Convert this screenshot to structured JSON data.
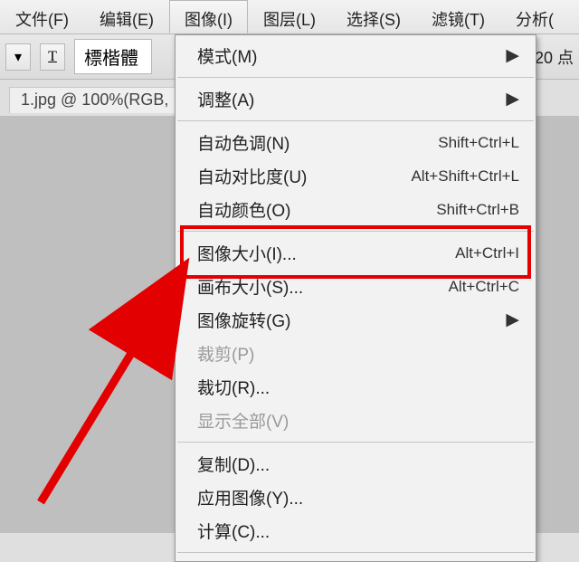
{
  "menubar": {
    "items": [
      {
        "label": "文件(F)"
      },
      {
        "label": "编辑(E)"
      },
      {
        "label": "图像(I)"
      },
      {
        "label": "图层(L)"
      },
      {
        "label": "选择(S)"
      },
      {
        "label": "滤镜(T)"
      },
      {
        "label": "分析("
      }
    ],
    "active_index": 2
  },
  "toolbar": {
    "font_name": "標楷體",
    "points_label": "20 点"
  },
  "doc_tab": {
    "label": "1.jpg @ 100%(RGB,"
  },
  "dropdown": {
    "groups": [
      [
        {
          "label": "模式(M)",
          "submenu": true
        }
      ],
      [
        {
          "label": "调整(A)",
          "submenu": true
        }
      ],
      [
        {
          "label": "自动色调(N)",
          "shortcut": "Shift+Ctrl+L"
        },
        {
          "label": "自动对比度(U)",
          "shortcut": "Alt+Shift+Ctrl+L"
        },
        {
          "label": "自动颜色(O)",
          "shortcut": "Shift+Ctrl+B"
        }
      ],
      [
        {
          "label": "图像大小(I)...",
          "shortcut": "Alt+Ctrl+I",
          "highlight": true
        },
        {
          "label": "画布大小(S)...",
          "shortcut": "Alt+Ctrl+C"
        },
        {
          "label": "图像旋转(G)",
          "submenu": true
        },
        {
          "label": "裁剪(P)",
          "disabled": true
        },
        {
          "label": "裁切(R)..."
        },
        {
          "label": "显示全部(V)",
          "disabled": true
        }
      ],
      [
        {
          "label": "复制(D)..."
        },
        {
          "label": "应用图像(Y)..."
        },
        {
          "label": "计算(C)..."
        }
      ]
    ]
  }
}
